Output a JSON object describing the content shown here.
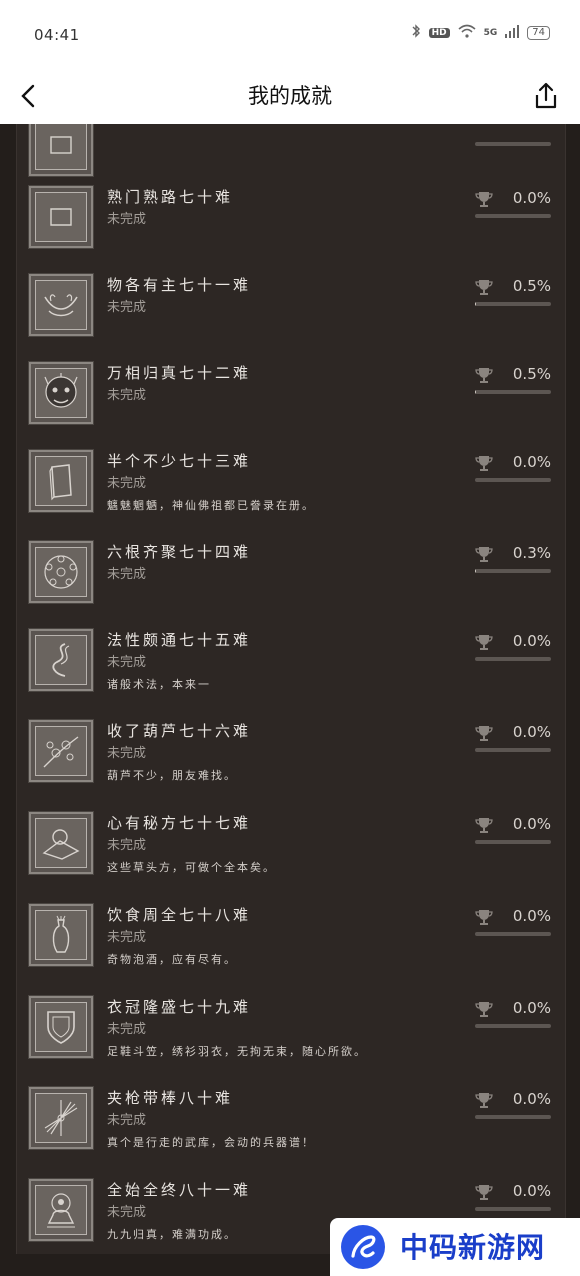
{
  "status_bar": {
    "time": "04:41",
    "network": "5G",
    "hd": "HD",
    "battery": "74"
  },
  "nav": {
    "title": "我的成就"
  },
  "achievements": [
    {
      "name": "",
      "status": "",
      "desc": "",
      "percent": "",
      "progress": 0,
      "icon": "scroll-icon"
    },
    {
      "name": "熟门熟路七十难",
      "status": "未完成",
      "desc": "",
      "percent": "0.0%",
      "progress": 0,
      "icon": "map-icon"
    },
    {
      "name": "物各有主七十一难",
      "status": "未完成",
      "desc": "",
      "percent": "0.5%",
      "progress": 0.005,
      "icon": "antlers-icon"
    },
    {
      "name": "万相归真七十二难",
      "status": "未完成",
      "desc": "",
      "percent": "0.5%",
      "progress": 0.005,
      "icon": "monkey-face-icon"
    },
    {
      "name": "半个不少七十三难",
      "status": "未完成",
      "desc": "魑魅魍魉，神仙佛祖都已誊录在册。",
      "percent": "0.0%",
      "progress": 0,
      "icon": "book-icon"
    },
    {
      "name": "六根齐聚七十四难",
      "status": "未完成",
      "desc": "",
      "percent": "0.3%",
      "progress": 0.003,
      "icon": "six-roots-icon"
    },
    {
      "name": "法性颇通七十五难",
      "status": "未完成",
      "desc": "诸般术法，本来一",
      "percent": "0.0%",
      "progress": 0,
      "icon": "swirl-icon"
    },
    {
      "name": "收了葫芦七十六难",
      "status": "未完成",
      "desc": "葫芦不少，朋友难找。",
      "percent": "0.0%",
      "progress": 0,
      "icon": "gourd-vine-icon"
    },
    {
      "name": "心有秘方七十七难",
      "status": "未完成",
      "desc": "这些草头方，可做个全本矣。",
      "percent": "0.0%",
      "progress": 0,
      "icon": "recipe-icon"
    },
    {
      "name": "饮食周全七十八难",
      "status": "未完成",
      "desc": "奇物泡酒，应有尽有。",
      "percent": "0.0%",
      "progress": 0,
      "icon": "vase-icon"
    },
    {
      "name": "衣冠隆盛七十九难",
      "status": "未完成",
      "desc": "足鞋斗笠，绣衫羽衣，无拘无束，随心所欲。",
      "percent": "0.0%",
      "progress": 0,
      "icon": "shield-icon"
    },
    {
      "name": "夹枪带棒八十难",
      "status": "未完成",
      "desc": "真个是行走的武库，会动的兵器谱！",
      "percent": "0.0%",
      "progress": 0,
      "icon": "weapons-icon"
    },
    {
      "name": "全始全终八十一难",
      "status": "未完成",
      "desc": "九九归真，难满功成。",
      "percent": "0.0%",
      "progress": 0,
      "icon": "meditating-figure-icon"
    }
  ],
  "watermark": {
    "text": "中码新游网"
  }
}
